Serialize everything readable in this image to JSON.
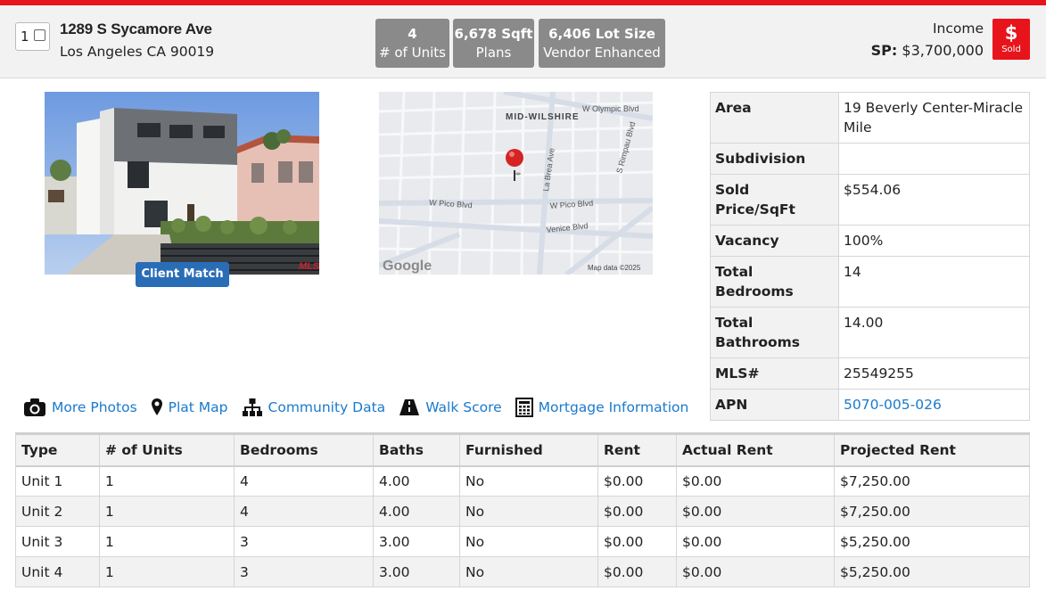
{
  "listing": {
    "index": "1",
    "address_line1": "1289 S Sycamore Ave",
    "address_line2": "Los Angeles CA 90019",
    "type": "Income",
    "price_label": "SP:",
    "price_value": "$3,700,000",
    "status_symbol": "$",
    "status": "Sold"
  },
  "stats": [
    {
      "value": "4",
      "label": "# of Units"
    },
    {
      "value": "6,678 Sqft",
      "label": "Plans"
    },
    {
      "value": "6,406 Lot Size",
      "label": "Vendor Enhanced"
    }
  ],
  "photo": {
    "button_label": "Client Match",
    "watermark": "MLS"
  },
  "map": {
    "district_label": "MID-WILSHIRE",
    "streets": [
      "W Olympic Blvd",
      "S Rimpau Blvd",
      "La Brea Ave",
      "W Pico Blvd",
      "W Pico Blvd",
      "Venice Blvd"
    ],
    "logo": "Google",
    "attribution": "Map data ©2025"
  },
  "details": [
    {
      "key": "Area",
      "value": "19 Beverly Center-Miracle Mile"
    },
    {
      "key": "Subdivision",
      "value": ""
    },
    {
      "key": "Sold Price/SqFt",
      "value": "$554.06"
    },
    {
      "key": "Vacancy",
      "value": "100%"
    },
    {
      "key": "Total Bedrooms",
      "value": "14"
    },
    {
      "key": "Total Bathrooms",
      "value": "14.00"
    },
    {
      "key": "MLS#",
      "value": "25549255"
    },
    {
      "key": "APN",
      "value": "5070-005-026"
    }
  ],
  "links": [
    {
      "label": "More Photos",
      "icon": "camera-icon"
    },
    {
      "label": "Plat Map",
      "icon": "map-pin-icon"
    },
    {
      "label": "Community Data",
      "icon": "sitemap-icon"
    },
    {
      "label": "Walk Score",
      "icon": "road-icon"
    },
    {
      "label": "Mortgage Information",
      "icon": "calculator-icon"
    }
  ],
  "units_table": {
    "columns": [
      "Type",
      "# of Units",
      "Bedrooms",
      "Baths",
      "Furnished",
      "Rent",
      "Actual Rent",
      "Projected Rent"
    ],
    "rows": [
      [
        "Unit 1",
        "1",
        "4",
        "4.00",
        "No",
        "$0.00",
        "$0.00",
        "$7,250.00"
      ],
      [
        "Unit 2",
        "1",
        "4",
        "4.00",
        "No",
        "$0.00",
        "$0.00",
        "$7,250.00"
      ],
      [
        "Unit 3",
        "1",
        "3",
        "3.00",
        "No",
        "$0.00",
        "$0.00",
        "$5,250.00"
      ],
      [
        "Unit 4",
        "1",
        "3",
        "3.00",
        "No",
        "$0.00",
        "$0.00",
        "$5,250.00"
      ]
    ]
  },
  "colors": {
    "accent_red": "#e8141c",
    "link_blue": "#1a7acc",
    "button_blue": "#2a6db7",
    "stat_gray": "#8a8a8a"
  }
}
